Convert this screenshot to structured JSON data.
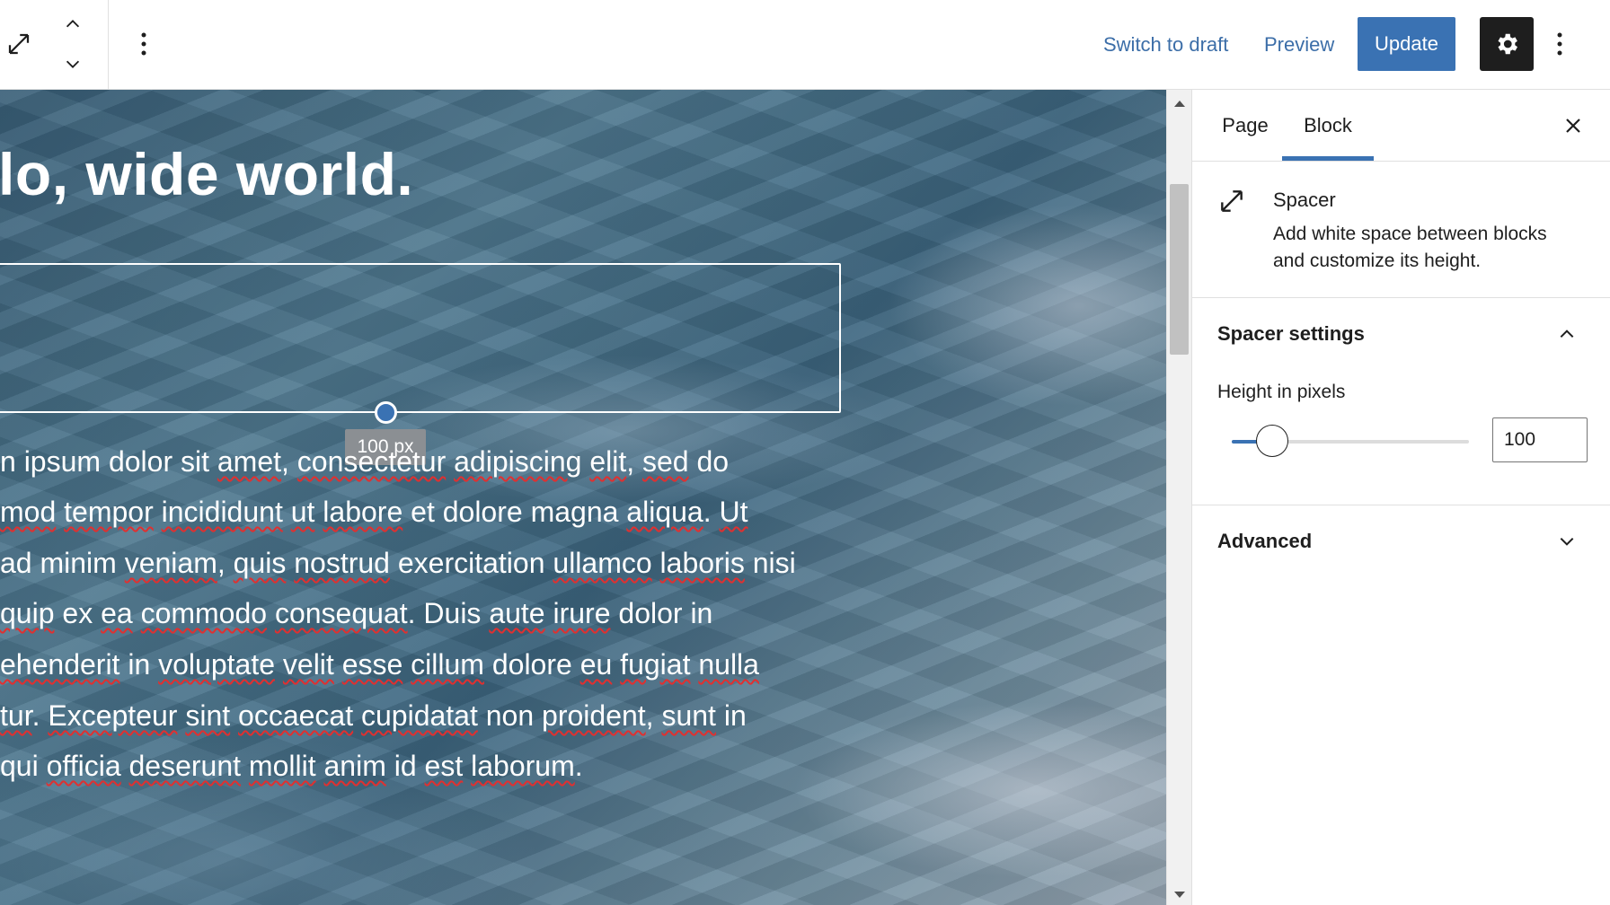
{
  "toolbar": {
    "switch_to_draft": "Switch to draft",
    "preview": "Preview",
    "update": "Update",
    "icons": [
      "resize-arrows-icon",
      "chevron-up-icon",
      "chevron-down-icon",
      "more-vertical-icon",
      "gear-icon",
      "more-vertical-icon"
    ]
  },
  "canvas": {
    "heading": "ello, wide world.",
    "spacer_tooltip": "100 px",
    "paragraph_lines": [
      [
        {
          "t": "n ipsum dolor sit "
        },
        {
          "t": "amet",
          "s": 1
        },
        {
          "t": ", "
        },
        {
          "t": "consectetur",
          "s": 1
        },
        {
          "t": " "
        },
        {
          "t": "adipiscing",
          "s": 1
        },
        {
          "t": " "
        },
        {
          "t": "elit",
          "s": 1
        },
        {
          "t": ", "
        },
        {
          "t": "sed",
          "s": 1
        },
        {
          "t": " do"
        }
      ],
      [
        {
          "t": "mod",
          "s": 1
        },
        {
          "t": " "
        },
        {
          "t": "tempor",
          "s": 1
        },
        {
          "t": " "
        },
        {
          "t": "incididunt",
          "s": 1
        },
        {
          "t": " "
        },
        {
          "t": "ut",
          "s": 1
        },
        {
          "t": " "
        },
        {
          "t": "labore",
          "s": 1
        },
        {
          "t": " et dolore magna "
        },
        {
          "t": "aliqua",
          "s": 1
        },
        {
          "t": ". "
        },
        {
          "t": "Ut",
          "s": 1
        }
      ],
      [
        {
          "t": " ad minim "
        },
        {
          "t": "veniam",
          "s": 1
        },
        {
          "t": ", "
        },
        {
          "t": "quis",
          "s": 1
        },
        {
          "t": " "
        },
        {
          "t": "nostrud",
          "s": 1
        },
        {
          "t": " exercitation "
        },
        {
          "t": "ullamco",
          "s": 1
        },
        {
          "t": " "
        },
        {
          "t": "laboris",
          "s": 1
        },
        {
          "t": " nisi"
        }
      ],
      [
        {
          "t": "quip",
          "s": 1
        },
        {
          "t": " ex "
        },
        {
          "t": "ea",
          "s": 1
        },
        {
          "t": " "
        },
        {
          "t": "commodo",
          "s": 1
        },
        {
          "t": " "
        },
        {
          "t": "consequat",
          "s": 1
        },
        {
          "t": ". Duis "
        },
        {
          "t": "aute",
          "s": 1
        },
        {
          "t": " "
        },
        {
          "t": "irure",
          "s": 1
        },
        {
          "t": " dolor in"
        }
      ],
      [
        {
          "t": "ehenderit",
          "s": 1
        },
        {
          "t": " in "
        },
        {
          "t": "voluptate",
          "s": 1
        },
        {
          "t": " "
        },
        {
          "t": "velit",
          "s": 1
        },
        {
          "t": " "
        },
        {
          "t": "esse",
          "s": 1
        },
        {
          "t": " "
        },
        {
          "t": "cillum",
          "s": 1
        },
        {
          "t": " dolore "
        },
        {
          "t": "eu",
          "s": 1
        },
        {
          "t": " "
        },
        {
          "t": "fugiat",
          "s": 1
        },
        {
          "t": " "
        },
        {
          "t": "nulla",
          "s": 1
        }
      ],
      [
        {
          "t": "tur",
          "s": 1
        },
        {
          "t": ". "
        },
        {
          "t": "Excepteur",
          "s": 1
        },
        {
          "t": " "
        },
        {
          "t": "sint",
          "s": 1
        },
        {
          "t": " "
        },
        {
          "t": "occaecat",
          "s": 1
        },
        {
          "t": " "
        },
        {
          "t": "cupidatat",
          "s": 1
        },
        {
          "t": " non "
        },
        {
          "t": "proident",
          "s": 1
        },
        {
          "t": ", "
        },
        {
          "t": "sunt",
          "s": 1
        },
        {
          "t": " in"
        }
      ],
      [
        {
          "t": " qui "
        },
        {
          "t": "officia",
          "s": 1
        },
        {
          "t": " "
        },
        {
          "t": "deserunt",
          "s": 1
        },
        {
          "t": " "
        },
        {
          "t": "mollit",
          "s": 1
        },
        {
          "t": " "
        },
        {
          "t": "anim",
          "s": 1
        },
        {
          "t": " id "
        },
        {
          "t": "est",
          "s": 1
        },
        {
          "t": " "
        },
        {
          "t": "laborum",
          "s": 1
        },
        {
          "t": "."
        }
      ]
    ]
  },
  "sidebar": {
    "tabs": [
      {
        "label": "Page",
        "active": false
      },
      {
        "label": "Block",
        "active": true
      }
    ],
    "block_card": {
      "icon": "resize-arrows-icon",
      "title": "Spacer",
      "description": "Add white space between blocks and customize its height."
    },
    "spacer_settings": {
      "title": "Spacer settings",
      "expanded": true,
      "height_label": "Height in pixels",
      "height_value": "100",
      "slider_fraction": 0.17
    },
    "advanced": {
      "title": "Advanced",
      "expanded": false
    }
  },
  "colors": {
    "accent": "#3a72b3",
    "dark": "#1e1e1e",
    "link": "#3c6ea8",
    "spell_error": "#e03030"
  }
}
